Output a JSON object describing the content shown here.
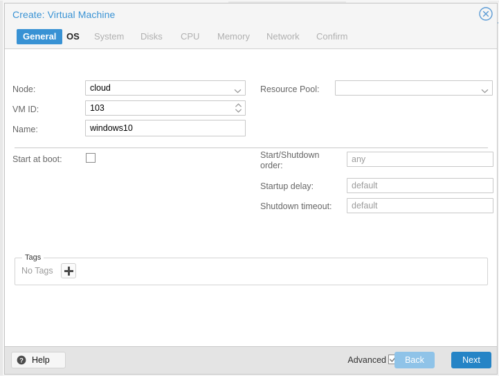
{
  "dialog": {
    "title": "Create: Virtual Machine",
    "close_icon": "close-circle-icon"
  },
  "tabs": [
    {
      "label": "General",
      "state": "active"
    },
    {
      "label": "OS",
      "state": "enabled"
    },
    {
      "label": "System",
      "state": "disabled"
    },
    {
      "label": "Disks",
      "state": "disabled"
    },
    {
      "label": "CPU",
      "state": "disabled"
    },
    {
      "label": "Memory",
      "state": "disabled"
    },
    {
      "label": "Network",
      "state": "disabled"
    },
    {
      "label": "Confirm",
      "state": "disabled"
    }
  ],
  "form": {
    "node": {
      "label": "Node:",
      "value": "cloud",
      "placeholder": ""
    },
    "vmid": {
      "label": "VM ID:",
      "value": "103",
      "placeholder": ""
    },
    "name": {
      "label": "Name:",
      "value": "windows10",
      "placeholder": ""
    },
    "resource_pool": {
      "label": "Resource Pool:",
      "value": "",
      "placeholder": ""
    },
    "start_at_boot": {
      "label": "Start at boot:",
      "checked": false
    },
    "start_shutdown_order": {
      "label": "Start/Shutdown order:",
      "value": "",
      "placeholder": "any"
    },
    "startup_delay": {
      "label": "Startup delay:",
      "value": "",
      "placeholder": "default"
    },
    "shutdown_timeout": {
      "label": "Shutdown timeout:",
      "value": "",
      "placeholder": "default"
    }
  },
  "tags": {
    "legend": "Tags",
    "empty_label": "No Tags",
    "add_icon": "plus-icon"
  },
  "footer": {
    "help_label": "Help",
    "help_icon": "question-circle-icon",
    "advanced_label": "Advanced",
    "advanced_checked": true,
    "back_label": "Back",
    "next_label": "Next"
  },
  "colors": {
    "accent": "#3892d4",
    "next_button": "#2584c6",
    "back_button": "#8fc3e8",
    "label_text": "#666666",
    "placeholder_text": "#9b9b9b",
    "disabled_tab": "#b0b0b0",
    "footer_bg": "#e4e4e4",
    "header_bg": "#f5f5f5"
  }
}
